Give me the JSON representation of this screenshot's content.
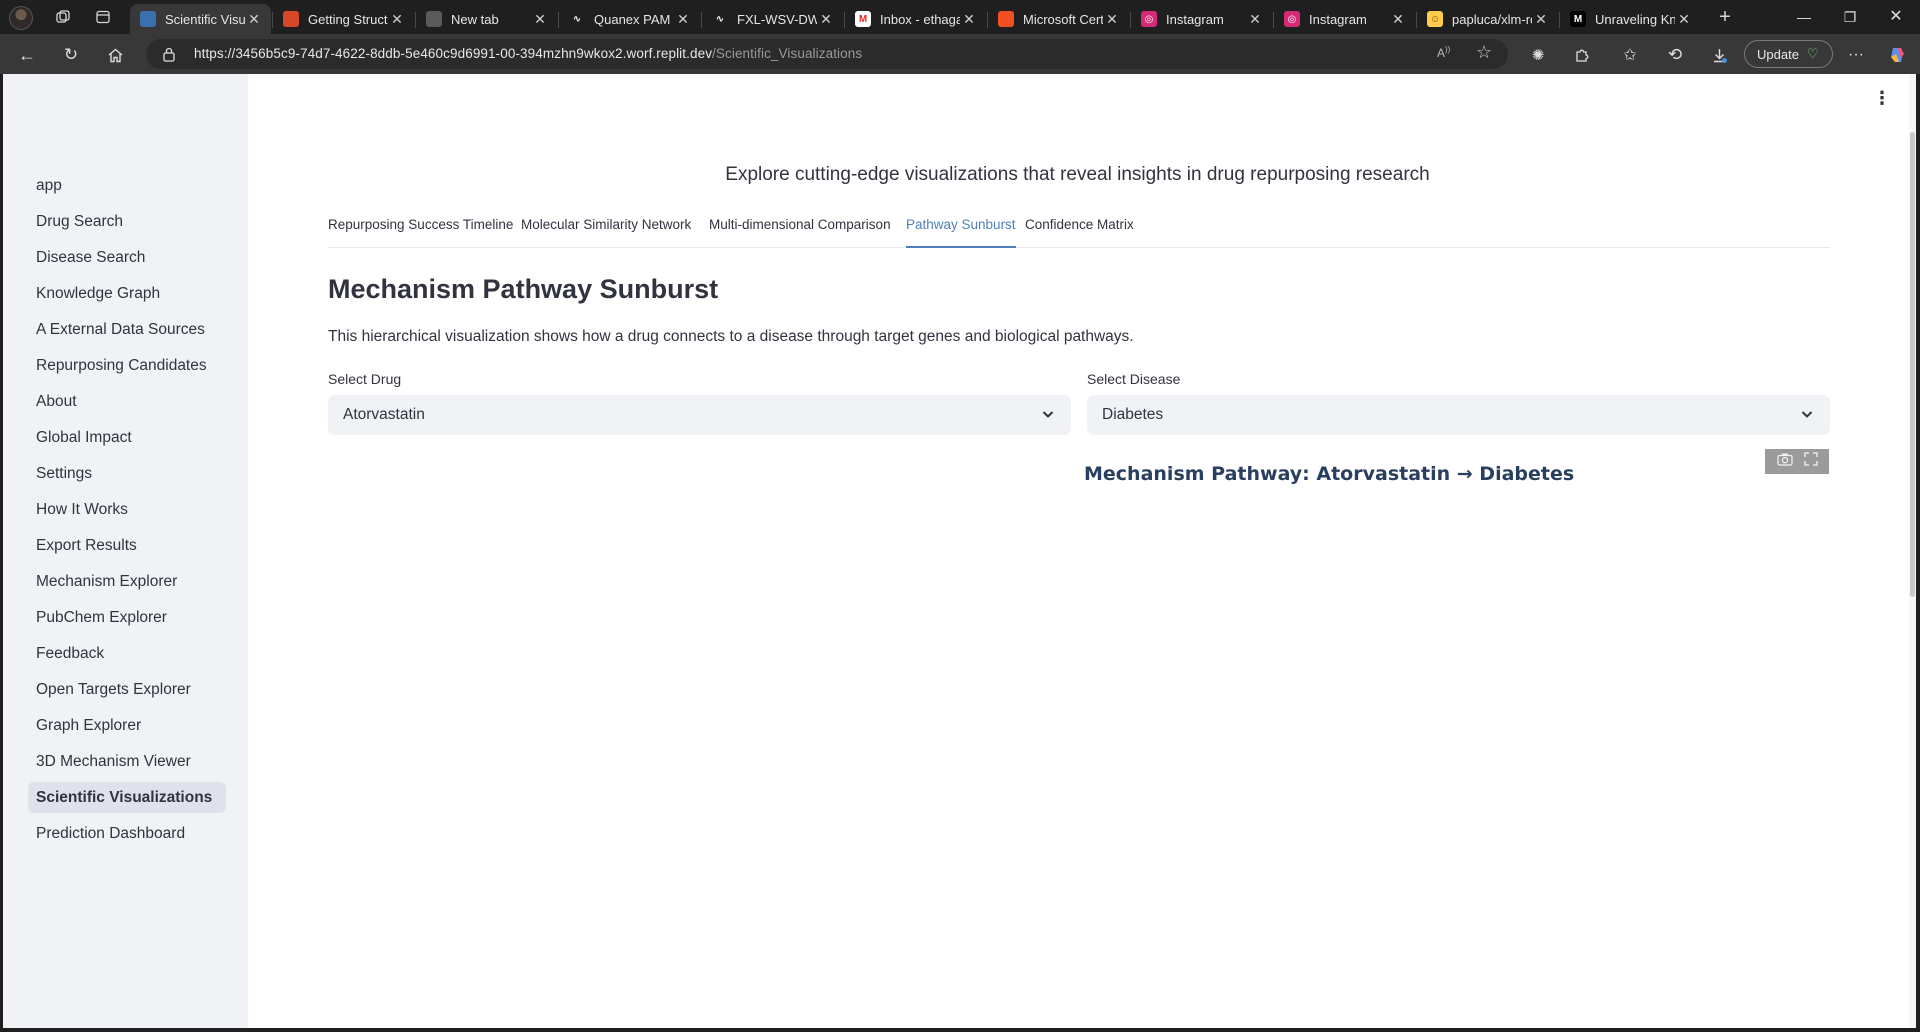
{
  "browser": {
    "tabs": [
      {
        "label": "Scientific Visual",
        "favicon_color": "#3a6fb0",
        "favicon_text": ""
      },
      {
        "label": "Getting Structu",
        "favicon_color": "#d9472b",
        "favicon_text": ""
      },
      {
        "label": "New tab",
        "favicon_color": "#5a5a5a",
        "favicon_text": ""
      },
      {
        "label": "Quanex PAM",
        "favicon_color": "#1f1f1f",
        "favicon_text": "∿"
      },
      {
        "label": "FXL-WSV-DW (",
        "favicon_color": "#1f1f1f",
        "favicon_text": "∿"
      },
      {
        "label": "Inbox - ethaga",
        "favicon_color": "#ffffff",
        "favicon_text": "M"
      },
      {
        "label": "Microsoft Certi",
        "favicon_color": "#f25022",
        "favicon_text": ""
      },
      {
        "label": "Instagram",
        "favicon_color": "#d62976",
        "favicon_text": "◎"
      },
      {
        "label": "Instagram",
        "favicon_color": "#d62976",
        "favicon_text": "◎"
      },
      {
        "label": "papluca/xlm-ro",
        "favicon_color": "#ffcc4d",
        "favicon_text": "☺"
      },
      {
        "label": "Unraveling Kno",
        "favicon_color": "#000000",
        "favicon_text": "M"
      }
    ],
    "url_host": "https://3456b5c9-74d7-4622-8ddb-5e460c9d6991-00-394mzhn9wkox2.worf.replit.dev",
    "url_path": "/Scientific_Visualizations",
    "update_label": "Update"
  },
  "sidebar": {
    "items": [
      "app",
      "Drug Search",
      "Disease Search",
      "Knowledge Graph",
      "A External Data Sources",
      "Repurposing Candidates",
      "About",
      "Global Impact",
      "Settings",
      "How It Works",
      "Export Results",
      "Mechanism Explorer",
      "PubChem Explorer",
      "Feedback",
      "Open Targets Explorer",
      "Graph Explorer",
      "3D Mechanism Viewer",
      "Scientific Visualizations",
      "Prediction Dashboard"
    ],
    "active_index": 17
  },
  "main": {
    "intro": "Explore cutting-edge visualizations that reveal insights in drug repurposing research",
    "tabs": [
      "Repurposing Success Timeline",
      "Molecular Similarity Network",
      "Multi-dimensional Comparison",
      "Pathway Sunburst",
      "Confidence Matrix"
    ],
    "active_tab": 3,
    "section_title": "Mechanism Pathway Sunburst",
    "section_desc": "This hierarchical visualization shows how a drug connects to a disease through target genes and biological pathways.",
    "drug_label": "Select Drug",
    "drug_value": "Atorvastatin",
    "disease_label": "Select Disease",
    "disease_value": "Diabetes",
    "chart_title": "Mechanism Pathway: Atorvastatin → Diabetes"
  },
  "colors": {
    "accent": "#4f7fb8",
    "text": "#31333f",
    "sidebar_bg": "#f0f2f6"
  }
}
